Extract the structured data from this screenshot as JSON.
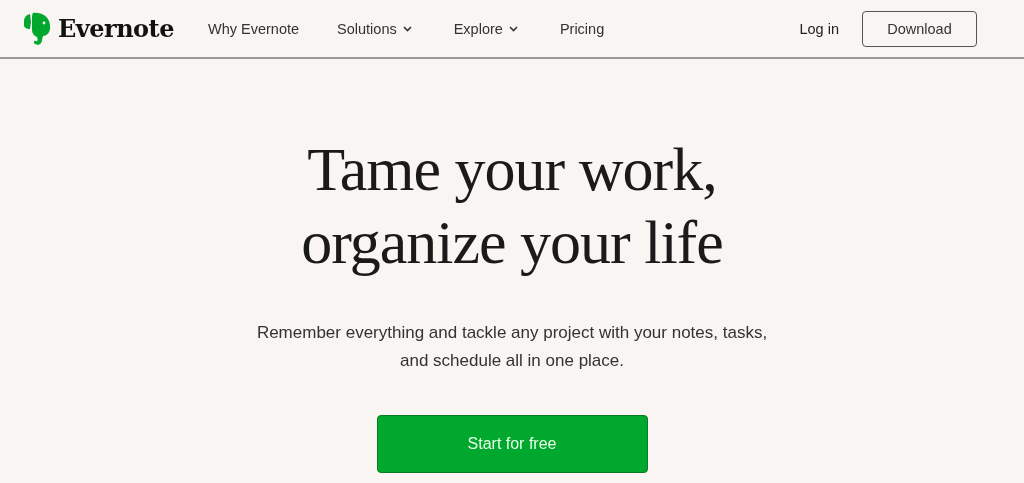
{
  "header": {
    "logo_text": "Evernote",
    "nav": [
      {
        "label": "Why Evernote",
        "kind": "link"
      },
      {
        "label": "Solutions",
        "kind": "dropdown"
      },
      {
        "label": "Explore",
        "kind": "dropdown"
      },
      {
        "label": "Pricing",
        "kind": "link"
      }
    ],
    "login": "Log in",
    "download": "Download"
  },
  "hero": {
    "headline": [
      "Tame your work,",
      "organize your life"
    ],
    "subtitle": "Remember everything and tackle any project with your notes, tasks, and schedule all in one place.",
    "cta": "Start for free"
  }
}
